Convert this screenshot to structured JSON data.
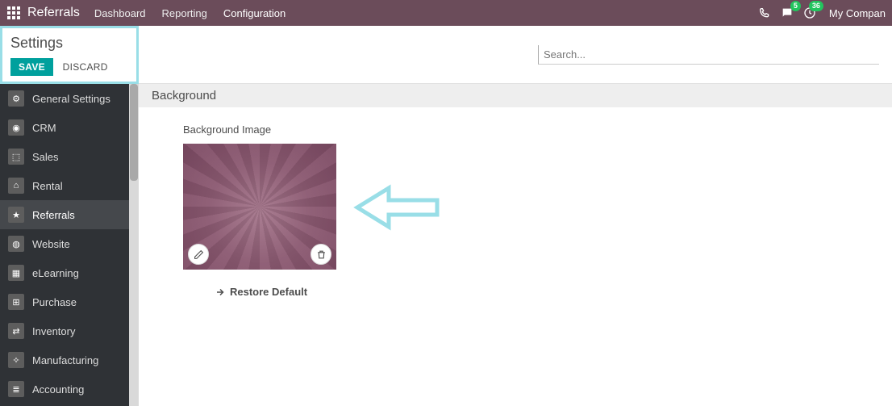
{
  "topbar": {
    "app_title": "Referrals",
    "nav": [
      "Dashboard",
      "Reporting",
      "Configuration"
    ],
    "messages_badge": "5",
    "activities_badge": "36",
    "company": "My Compan"
  },
  "settings_head": {
    "title": "Settings",
    "save_label": "SAVE",
    "discard_label": "DISCARD"
  },
  "search": {
    "placeholder": "Search..."
  },
  "sidebar": {
    "items": [
      {
        "label": "General Settings",
        "glyph": "⚙"
      },
      {
        "label": "CRM",
        "glyph": "◉"
      },
      {
        "label": "Sales",
        "glyph": "⬚"
      },
      {
        "label": "Rental",
        "glyph": "⌂"
      },
      {
        "label": "Referrals",
        "glyph": "★"
      },
      {
        "label": "Website",
        "glyph": "◍"
      },
      {
        "label": "eLearning",
        "glyph": "▦"
      },
      {
        "label": "Purchase",
        "glyph": "⊞"
      },
      {
        "label": "Inventory",
        "glyph": "⇄"
      },
      {
        "label": "Manufacturing",
        "glyph": "✧"
      },
      {
        "label": "Accounting",
        "glyph": "≣"
      }
    ],
    "active_index": 4
  },
  "content": {
    "section_title": "Background",
    "field_label": "Background Image",
    "restore_label": "Restore Default"
  }
}
